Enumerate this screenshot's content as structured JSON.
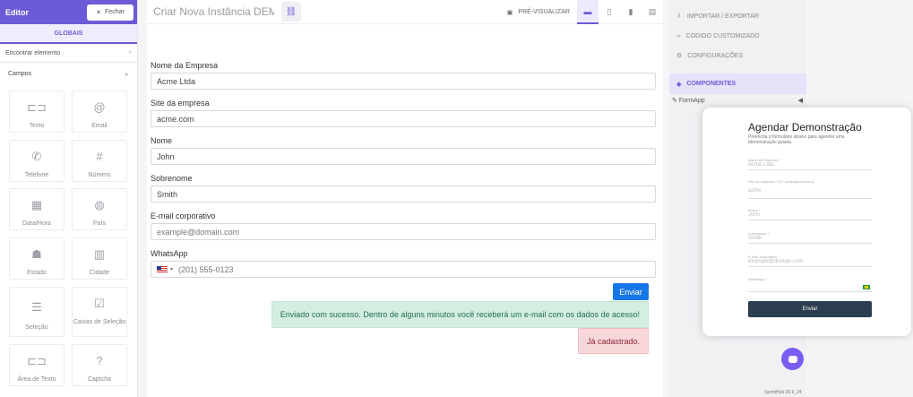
{
  "editor": {
    "title": "Editor",
    "close_label": "Fechar",
    "tab_label": "GLOBAIS",
    "search_placeholder": "Encontrar elemento",
    "section_label": "Campos",
    "tiles": [
      {
        "label": "Texto",
        "icon": "text-field-icon",
        "glyph": "⊏⊐"
      },
      {
        "label": "Email",
        "icon": "at-icon",
        "glyph": "@"
      },
      {
        "label": "Telefone",
        "icon": "phone-icon",
        "glyph": "✆"
      },
      {
        "label": "Número",
        "icon": "hash-icon",
        "glyph": "#"
      },
      {
        "label": "Data/Hora",
        "icon": "calendar-icon",
        "glyph": "▦"
      },
      {
        "label": "País",
        "icon": "globe-icon",
        "glyph": "◍"
      },
      {
        "label": "Estado",
        "icon": "map-icon",
        "glyph": "☗"
      },
      {
        "label": "Cidade",
        "icon": "city-icon",
        "glyph": "▥"
      },
      {
        "label": "Seleção",
        "icon": "list-icon",
        "glyph": "☰"
      },
      {
        "label": "Caixas de Seleção",
        "icon": "checkbox-icon",
        "glyph": "☑"
      },
      {
        "label": "Área de Texto",
        "icon": "textarea-icon",
        "glyph": "⊏⊐"
      },
      {
        "label": "Captcha",
        "icon": "question-icon",
        "glyph": "?"
      }
    ]
  },
  "canvas": {
    "doc_title": "Criar Nova Instância DEMO",
    "preview_label": "PRÉ-VISUALIZAR",
    "fields": [
      {
        "label": "Nome da Empresa",
        "value": "Acme Ltda"
      },
      {
        "label": "Site da empresa",
        "value": "acme.com"
      },
      {
        "label": "Nome",
        "value": "John"
      },
      {
        "label": "Sobrenome",
        "value": "Smith"
      },
      {
        "label": "E-mail corporativo",
        "value": "example@domain.com"
      },
      {
        "label": "WhatsApp",
        "value": "(201) 555-0123"
      }
    ],
    "submit_label": "Enviar",
    "success_message": "Enviado com sucesso. Dentro de alguns minutos você receberá um e-mail com os dados de acesso!",
    "error_message": "Já cadastrado."
  },
  "sidebar": {
    "items": [
      {
        "label": "IMPORTAR / EXPORTAR",
        "icon": "import-icon"
      },
      {
        "label": "CÓDIGO CUSTOMIZADO",
        "icon": "code-icon"
      },
      {
        "label": "CONFIGURAÇÕES",
        "icon": "settings-icon"
      },
      {
        "label": "COMPONENTES",
        "icon": "layers-icon"
      }
    ],
    "formapp_label": "FormApp"
  },
  "preview_card": {
    "title": "Agendar Demonstração",
    "subtitle": "Preencha o formulário abaixo para agendar uma demonstração guiada.",
    "fields": [
      {
        "label": "Nome da Empresa *",
        "placeholder": "Acme Ltda"
      },
      {
        "label": "Site da empresa * (Ex: suaempresa.com)",
        "placeholder": "acme"
      },
      {
        "label": "Nome *",
        "placeholder": "John"
      },
      {
        "label": "Sobrenome *",
        "placeholder": "Smith"
      },
      {
        "label": "E-mail corporativo *",
        "placeholder": "example@domain.com"
      },
      {
        "label": "WhatsApp *",
        "placeholder": ""
      }
    ],
    "button_label": "Enviar"
  },
  "version": "SprintHub 20.6_24",
  "colors": {
    "accent": "#6b5bd6",
    "submit": "#1677e6",
    "card_button": "#2c3e50"
  }
}
